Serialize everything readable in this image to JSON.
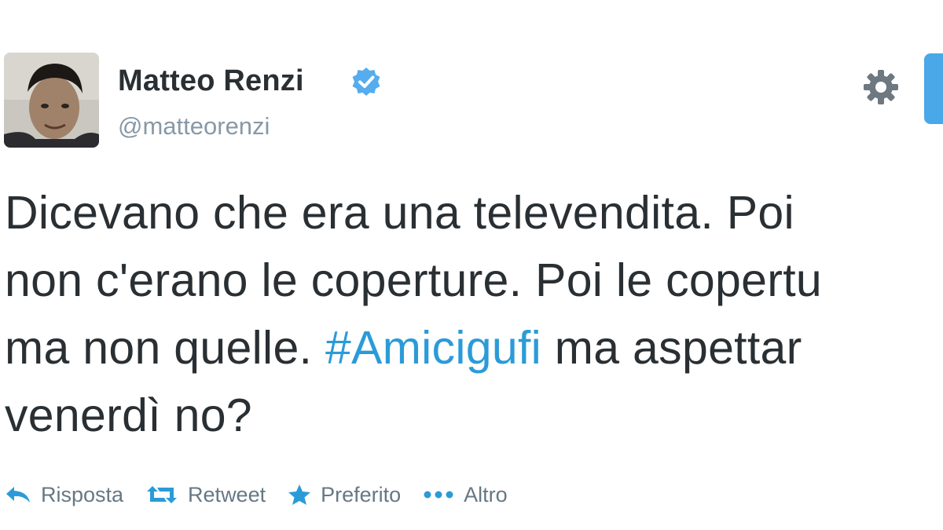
{
  "author": {
    "name": "Matteo Renzi",
    "handle": "@matteorenzi",
    "avatar_icon": "profile-photo",
    "verified_icon": "verified-badge-icon"
  },
  "tweet": {
    "line_1": "Dicevano che era una televendita. Poi",
    "line_2": "non c'erano le coperture. Poi le copertu",
    "line_3_before": "ma non quelle. ",
    "hashtag": "#Amicigufi",
    "line_3_after": " ma aspettar",
    "line_4": "venerdì no?"
  },
  "actions": {
    "reply": "Risposta",
    "retweet": "Retweet",
    "favorite": "Preferito",
    "more": "Altro"
  },
  "colors": {
    "text": "#292f33",
    "muted": "#8899a6",
    "action": "#667884",
    "link": "#2b9bd8",
    "verified": "#55acee"
  }
}
